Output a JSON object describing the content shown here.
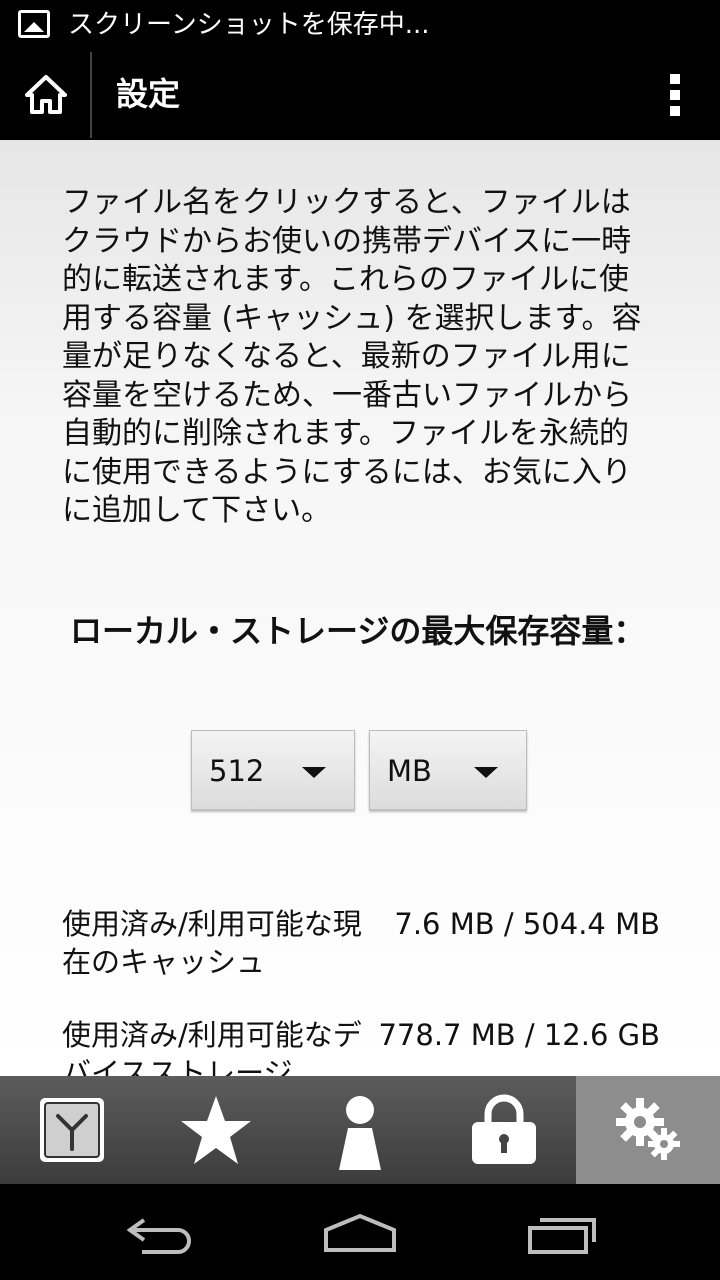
{
  "status_bar": {
    "notification_text": "スクリーンショットを保存中..."
  },
  "action_bar": {
    "title": "設定"
  },
  "description": "ファイル名をクリックすると、ファイルはクラウドからお使いの携帯デバイスに一時的に転送されます。これらのファイルに使用する容量 (キャッシュ) を選択します。容量が足りなくなると、最新のファイル用に容量を空けるため、一番古いファイルから自動的に削除されます。ファイルを永続的に使用できるようにするには、お気に入りに追加して下さい。",
  "storage": {
    "heading": "ローカル・ストレージの最大保存容量：",
    "size_value": "512",
    "unit_value": "MB"
  },
  "info": {
    "cache_label": "使用済み/利用可能な現在のキャッシュ",
    "cache_value": "7.6 MB / 504.4 MB",
    "device_label": "使用済み/利用可能なデバイスストレージ",
    "device_value": "778.7 MB / 12.6 GB"
  },
  "tabs": [
    {
      "icon": "clock-icon"
    },
    {
      "icon": "star-icon"
    },
    {
      "icon": "person-icon"
    },
    {
      "icon": "lock-icon"
    },
    {
      "icon": "gears-icon",
      "selected": true
    }
  ],
  "colors": {
    "bar_background": "#000000",
    "selected_tab": "#8d8d8d",
    "tab_bar": "#4a4a4a"
  }
}
